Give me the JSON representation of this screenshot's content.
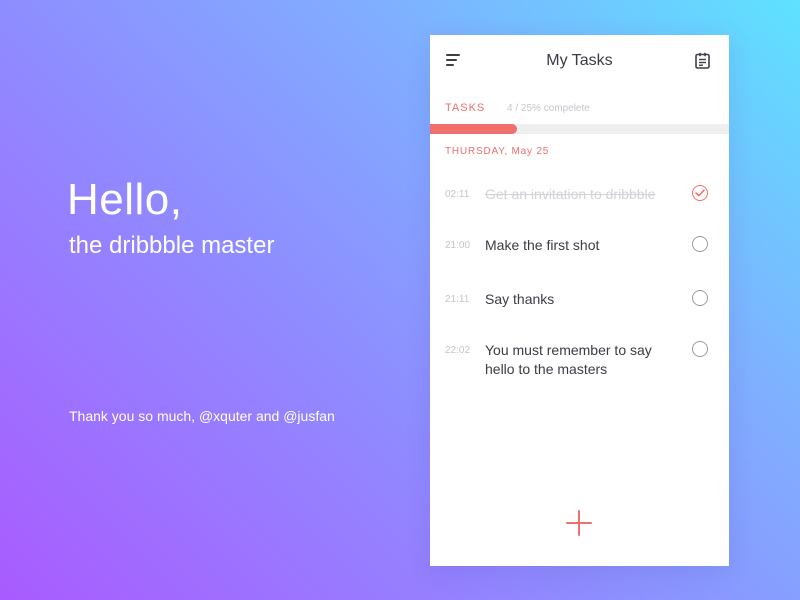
{
  "hero": {
    "title": "Hello,",
    "subtitle": "the dribbble master",
    "thanks": "Thank you so much, @xquter and @jusfan"
  },
  "app": {
    "title": "My Tasks",
    "menu_icon": "menu-icon",
    "calendar_icon": "calendar-icon",
    "tasks_label": "TASKS",
    "progress_text": "4 / 25% compelete",
    "progress_fraction": 0.29,
    "date_label": "THURSDAY, May 25",
    "accent_color": "#ef6f6c",
    "tasks": [
      {
        "time": "02:11",
        "text": "Get an invitation to dribbble",
        "done": true
      },
      {
        "time": "21:00",
        "text": "Make the first shot",
        "done": false
      },
      {
        "time": "21:11",
        "text": "Say thanks",
        "done": false
      },
      {
        "time": "22:02",
        "text": "You must remember to say hello to the masters",
        "done": false
      }
    ],
    "add_icon": "plus-icon"
  }
}
